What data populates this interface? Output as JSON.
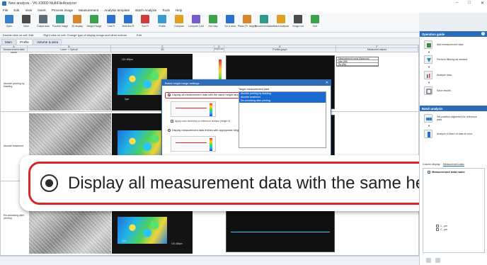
{
  "window": {
    "title": "New analysis - VK-X3000 MultiFileAnalyzer",
    "controls": [
      "–",
      "□",
      "✕"
    ]
  },
  "menu": [
    "File",
    "Edit",
    "View",
    "Insert",
    "Process image",
    "Measurement",
    "Analysis template",
    "Batch Analysis",
    "Tools",
    "Help"
  ],
  "toolbar": [
    {
      "label": "Open",
      "color": "#3b7fc9"
    },
    {
      "label": "Save",
      "color": "#4b4b4b"
    },
    {
      "label": "Output data",
      "color": "#5a6b7c"
    },
    {
      "label": "Process image",
      "color": "#2c9a8c"
    },
    {
      "label": "3D display",
      "color": "#d9862a"
    },
    {
      "label": "Height Range",
      "color": "#3aa34a"
    },
    {
      "label": "Line R",
      "color": "#2a6fd0"
    },
    {
      "label": "Multi-line R",
      "color": "#2a6fd0"
    },
    {
      "label": "Surf R",
      "color": "#d03a3a"
    },
    {
      "label": "Profile",
      "color": "#3a9bd0"
    },
    {
      "label": "Compare",
      "color": "#e0a020"
    },
    {
      "label": "Compare CAD",
      "color": "#7a5ad0"
    },
    {
      "label": "Ave step",
      "color": "#3aa34a"
    },
    {
      "label": "Vol & area",
      "color": "#2a6fd0"
    },
    {
      "label": "Plane (Pr. height)",
      "color": "#d9862a"
    },
    {
      "label": "Recommendation",
      "color": "#2c9a8c"
    },
    {
      "label": "Batch Analysis",
      "color": "#e0a020"
    },
    {
      "label": "Image List",
      "color": "#4b4b4b"
    },
    {
      "label": "Sort",
      "color": "#3aa34a"
    }
  ],
  "hints": {
    "double_click": "Double click on cell: Edit",
    "right_click": "Right click on cell: Change type of display image and other actions",
    "edit": "Edit"
  },
  "tabs": [
    "Main",
    "Profile",
    "Volume & area"
  ],
  "columns": [
    "A",
    "B",
    "C",
    "D",
    "E",
    "F"
  ],
  "col_headers": {
    "a": "Measurement data name",
    "b": "Laser + Optical",
    "c": "3D",
    "d": "Height color",
    "e": "Profile graph",
    "f": "Measured values",
    "de_group": "Profile",
    "ef_group": "Standard"
  },
  "rows": [
    {
      "name": "Alumite peeling by blasting",
      "scale_top": "151.480μm",
      "scale_bottom": "0μm"
    },
    {
      "name": "Alumite treatment",
      "scale_top": "",
      "scale_bottom": ""
    },
    {
      "name": "Re-anodizing after peeling",
      "scale_top": "151.480μm",
      "scale_bottom": "0μm"
    }
  ],
  "measure_table": [
    "Measurement name  Measured",
    "Max (Wt)",
    "Ra (Wt)"
  ],
  "dialog": {
    "title": "Batch height range settings",
    "close": "✕",
    "opt1": "Display all measurement data with the same height range",
    "opt2": "Display measurement data entries with appropriate height ranges",
    "check": "Apply color centered on reference surface (height 0)",
    "target_label": "Target measurement data",
    "targets": [
      "Alumite peeling by blasting",
      "Alumite treatment",
      "Re-anodizing after peeling"
    ]
  },
  "callout": {
    "text": "Display all measurement data with the same height range"
  },
  "guide": {
    "header": "Operation guide",
    "help": "?",
    "steps": [
      {
        "text": "Add measurement data.",
        "icon": "add-data-icon"
      },
      {
        "text": "Perform filtering as needed.",
        "icon": "filter-icon"
      },
      {
        "text": "Analyze data.",
        "icon": "analyze-icon"
      },
      {
        "text": "Save results.",
        "icon": "save-icon"
      }
    ]
  },
  "batch": {
    "header": "Batch analysis",
    "steps": [
      "Set position alignment for reference data.",
      "Analyze a batch of data at once."
    ]
  },
  "panel_tabs": [
    "Column display",
    "Measurement data"
  ],
  "tree": {
    "header": "Measurement data name",
    "items": [
      "1 - μm",
      "2 - μm"
    ]
  },
  "accent": "#2e6db5",
  "highlight": "#d9262a"
}
